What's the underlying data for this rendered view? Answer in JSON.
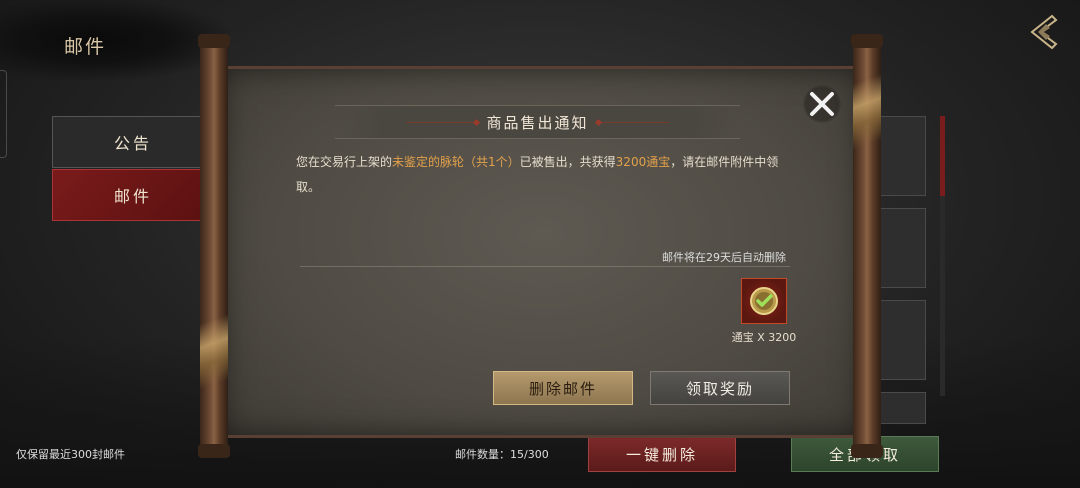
{
  "header": {
    "title": "邮件"
  },
  "tabs": [
    {
      "label": "公告",
      "active": false
    },
    {
      "label": "邮件",
      "active": true
    }
  ],
  "footer": {
    "note": "仅保留最近300封邮件",
    "count": "邮件数量：15/300",
    "delete_all_label": "一键删除",
    "claim_all_label": "全部领取"
  },
  "dialog": {
    "title": "商品售出通知",
    "body": {
      "part1": "您在交易行上架的",
      "item": "未鉴定的脉轮（共1个）",
      "part2": "已被售出，共获得",
      "reward": "3200通宝",
      "part3": "，请在邮件附件中领取。"
    },
    "expire_text": "邮件将在29天后自动删除",
    "attachment": {
      "caption": "通宝 X 3200",
      "icon": "coin-check-icon"
    },
    "delete_label": "删除邮件",
    "claim_label": "领取奖励",
    "close_icon": "close-icon"
  },
  "colors": {
    "highlight": "#e3a14b",
    "mail_tab": "#7a1b1b",
    "delete_all": "#7d2a2a",
    "claim_all": "#3f5a3d"
  }
}
